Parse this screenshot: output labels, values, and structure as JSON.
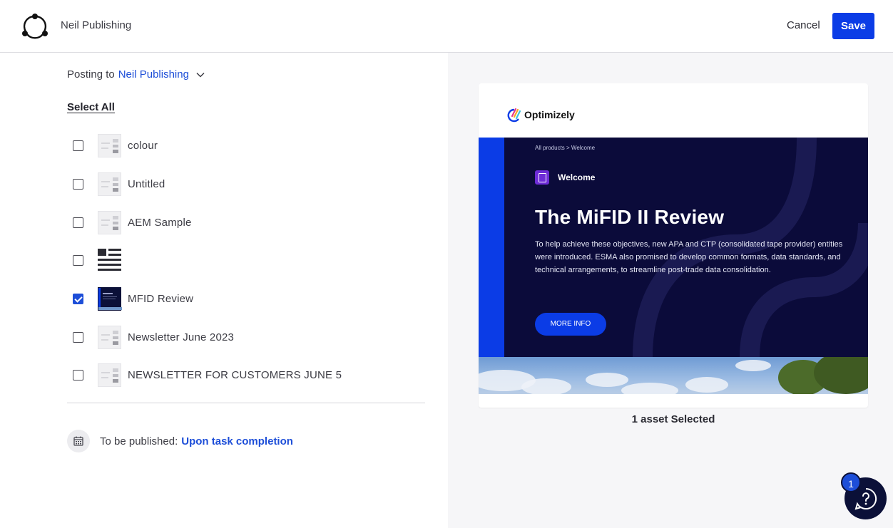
{
  "header": {
    "app_title": "Neil Publishing",
    "cancel_label": "Cancel",
    "save_label": "Save"
  },
  "posting": {
    "prefix": "Posting to",
    "target": "Neil Publishing"
  },
  "select_all_label": "Select All",
  "assets": [
    {
      "label": "colour",
      "checked": false,
      "thumb": "blank-doc"
    },
    {
      "label": "Untitled",
      "checked": false,
      "thumb": "blank-doc"
    },
    {
      "label": "AEM Sample",
      "checked": false,
      "thumb": "blank-doc"
    },
    {
      "label": "",
      "checked": false,
      "thumb": "article-icon"
    },
    {
      "label": "MFID Review",
      "checked": true,
      "thumb": "page-preview"
    },
    {
      "label": "Newsletter June 2023",
      "checked": false,
      "thumb": "blank-doc"
    },
    {
      "label": "NEWSLETTER FOR CUSTOMERS JUNE 5",
      "checked": false,
      "thumb": "blank-doc"
    }
  ],
  "publish": {
    "prefix": "To be published:",
    "when": "Upon task completion"
  },
  "preview": {
    "brand": "Optimizely",
    "breadcrumb": "All products  >  Welcome",
    "welcome": "Welcome",
    "title": "The MiFID II Review",
    "body": "To help achieve these objectives, new APA and CTP (consolidated tape provider) entities were introduced. ESMA also promised to develop common formats, data standards, and technical arrangements, to streamline post-trade data consolidation.",
    "button": "MORE INFO",
    "selection_count": "1 asset Selected"
  },
  "help": {
    "badge": "1"
  },
  "colors": {
    "accent": "#0b3ce6",
    "link": "#1d4ed8",
    "hero_bg": "#0b0b3a",
    "preview_bg": "#f6f6f8"
  }
}
